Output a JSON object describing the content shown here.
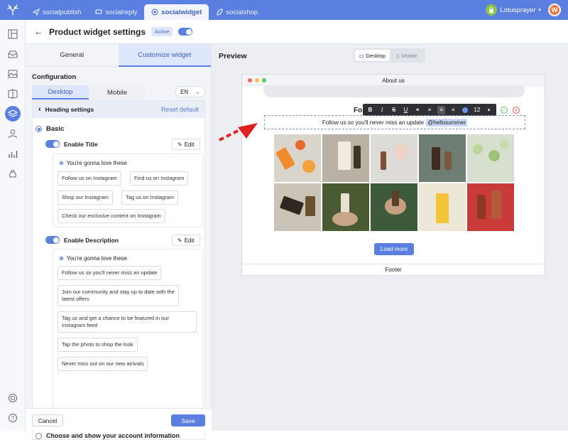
{
  "nav": {
    "tabs": [
      {
        "label": "socialpublish"
      },
      {
        "label": "socialreply"
      },
      {
        "label": "socialwidget"
      },
      {
        "label": "socialshop"
      }
    ],
    "store_name": "Lotusprayer",
    "avatar_letter": "W"
  },
  "header": {
    "title": "Product widget settings",
    "status": "Active"
  },
  "left_tabs": [
    "General",
    "Customize widget"
  ],
  "config": {
    "title": "Configuration",
    "device_tabs": [
      "Desktop",
      "Mobile"
    ],
    "language": "EN",
    "heading_settings": "Heading settings",
    "reset_default": "Reset default",
    "basic": "Basic",
    "enable_title": "Enable Title",
    "enable_description": "Enable Description",
    "edit": "Edit",
    "suggestion_title": "You're gonna love these",
    "title_chips": [
      "Follow us on Instagram",
      "Find us on Instagram",
      "Shop our Instagram",
      "Tag us on Instagram",
      "Check our exclusive content on Instagram"
    ],
    "desc_chips": [
      "Follow us so you'll never miss an update",
      "Join our community and stay up to date with the latest offers",
      "Tag us and get a chance to be featured in our Instagram feed",
      "Tap the photo to shop the look",
      "Never miss out on our new arrivals"
    ],
    "account_option": "Choose and show your account information"
  },
  "actions": {
    "cancel": "Cancel",
    "save": "Save"
  },
  "preview": {
    "title": "Preview",
    "modes": [
      "Desktop",
      "Mobile"
    ],
    "window_title": "About us",
    "heading_fragment": "Fo",
    "description_text": "Follow us so you'll never miss an update",
    "handle": "@hellosummer",
    "font_size": "12",
    "load_more": "Load more",
    "footer": "Footer"
  },
  "colors": {
    "accent": "#5a7fe0",
    "arrow": "#e02020"
  }
}
